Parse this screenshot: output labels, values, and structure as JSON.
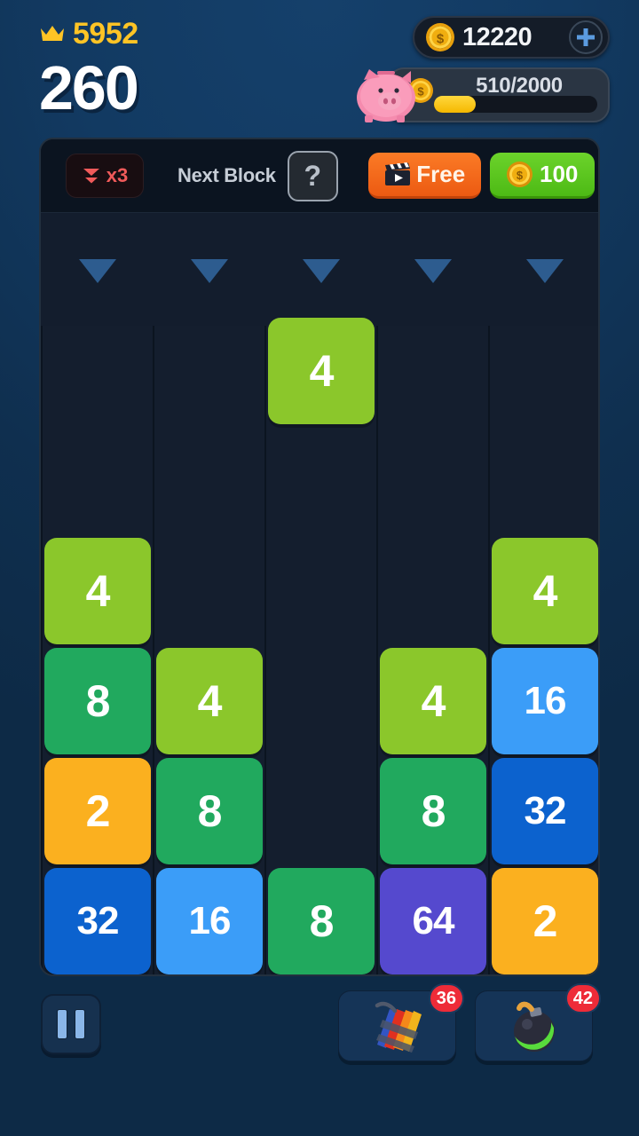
{
  "hud": {
    "best_score": "5952",
    "current_score": "260",
    "crown_icon": "crown-icon",
    "coins": {
      "amount": "12220",
      "coin_icon": "coin-icon",
      "add_label": "+"
    },
    "piggy": {
      "icon": "piggy-bank-icon",
      "coin_icon": "coin-icon",
      "progress_text": "510/2000",
      "current": 510,
      "max": 2000,
      "fill_percent": 25.5,
      "fill_color": "#FFD83D"
    }
  },
  "toolbar": {
    "multiplier": {
      "icon": "double-chevron-down-icon",
      "label": "x3",
      "color": "#F05A5A"
    },
    "next_block_label": "Next Block",
    "next_block_value": "?",
    "free_button": {
      "label": "Free",
      "icon": "clapperboard-icon",
      "color": "#EC5A12"
    },
    "coin_button": {
      "label": "100",
      "icon": "coin-icon",
      "color": "#4DBA15"
    }
  },
  "board": {
    "columns": 5,
    "rows": 6,
    "drop_arrow_color": "#2D5C8F",
    "tile_colors": {
      "2": "#FBB01F",
      "4": "#8BC72B",
      "8": "#21A95E",
      "16": "#3B9DF8",
      "32": "#0C62CE",
      "64": "#5549CE"
    },
    "grid": [
      [
        null,
        null,
        "4",
        null,
        null
      ],
      [
        null,
        null,
        null,
        null,
        null
      ],
      [
        "4",
        null,
        null,
        null,
        "4"
      ],
      [
        "8",
        "4",
        null,
        "4",
        "16"
      ],
      [
        "2",
        "8",
        null,
        "8",
        "32"
      ],
      [
        "32",
        "16",
        "8",
        "64",
        "2"
      ]
    ]
  },
  "bottom": {
    "pause_label": "Pause",
    "powerups": [
      {
        "name": "dynamite",
        "icon": "dynamite-icon",
        "count": "36"
      },
      {
        "name": "bomb",
        "icon": "bomb-icon",
        "count": "42"
      }
    ]
  }
}
